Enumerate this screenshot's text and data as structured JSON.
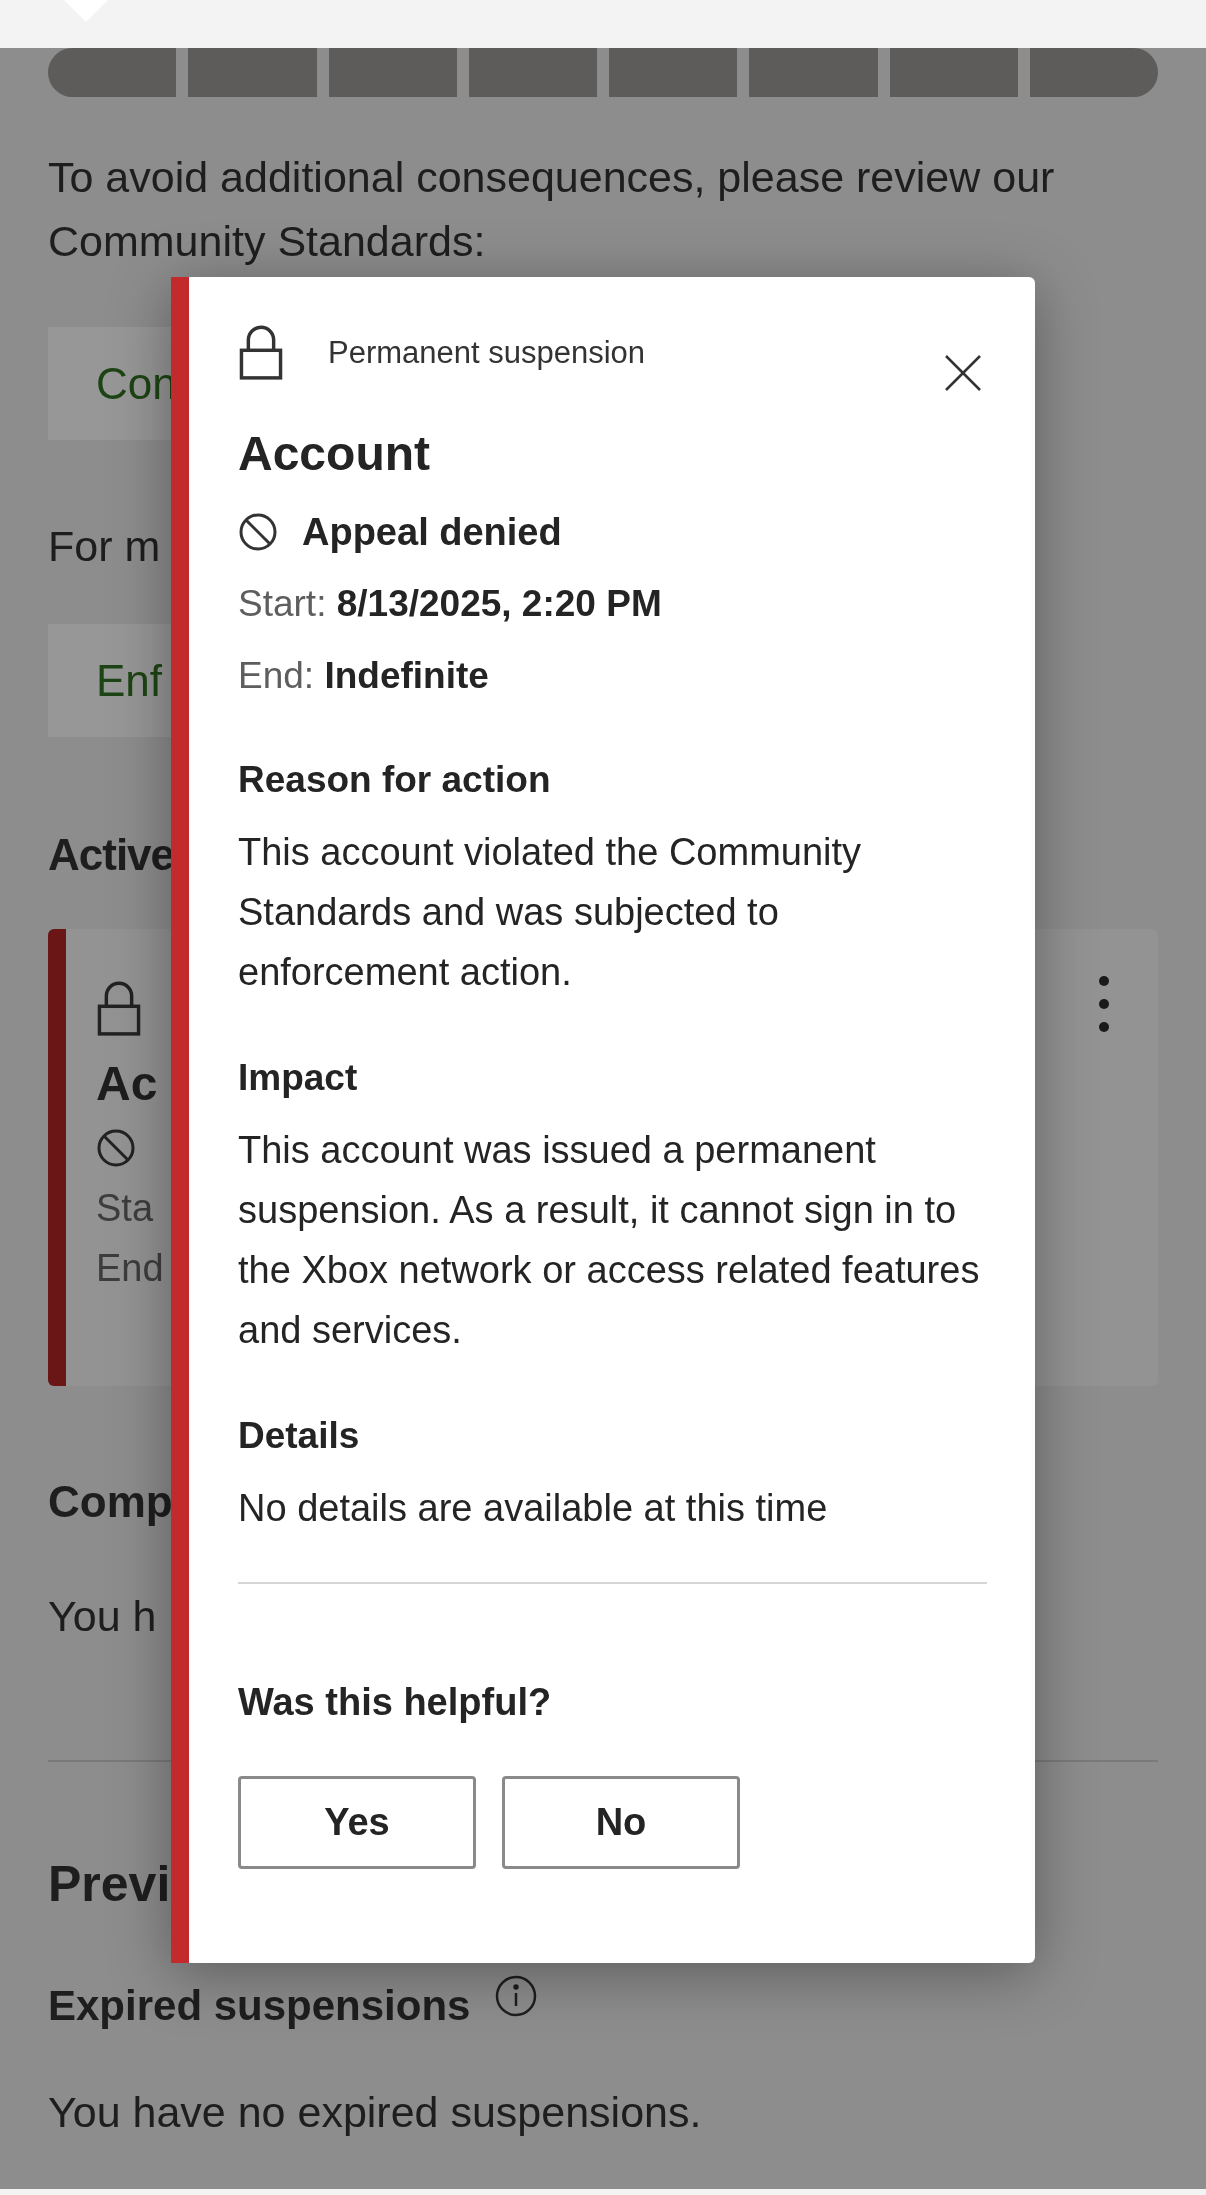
{
  "strike_meter": [
    {
      "filled": true
    },
    {
      "filled": true
    },
    {
      "filled": true
    },
    {
      "filled": true
    },
    {
      "filled": true
    },
    {
      "filled": true
    },
    {
      "filled": true
    },
    {
      "filled": true
    }
  ],
  "page": {
    "intro_text": "To avoid additional consequences, please review our Community Standards:",
    "standards_link": "Con",
    "more_info_text": "For m",
    "enforcement_link": "Enf",
    "active_heading": "Active",
    "active_card": {
      "title": "Ac",
      "start_label": "Sta",
      "end_label": "End"
    },
    "compliance_heading": "Comp",
    "compliance_text": "You h",
    "previous_heading": "Previ",
    "expired_heading": "Expired suspensions",
    "expired_text": "You have no expired suspensions."
  },
  "dialog": {
    "category": "Permanent suspension",
    "title": "Account",
    "status": "Appeal denied",
    "start_label": "Start:",
    "start_value": "8/13/2025, 2:20 PM",
    "end_label": "End:",
    "end_value": "Indefinite",
    "sections": [
      {
        "heading": "Reason for action",
        "body": "This account violated the Community Standards and was subjected to enforcement action."
      },
      {
        "heading": "Impact",
        "body": "This account was issued a permanent suspension. As a result, it cannot sign in to the Xbox network or access related features and services."
      },
      {
        "heading": "Details",
        "body": "No details are available at this time"
      }
    ],
    "feedback_question": "Was this helpful?",
    "buttons": [
      "Yes",
      "No"
    ]
  }
}
